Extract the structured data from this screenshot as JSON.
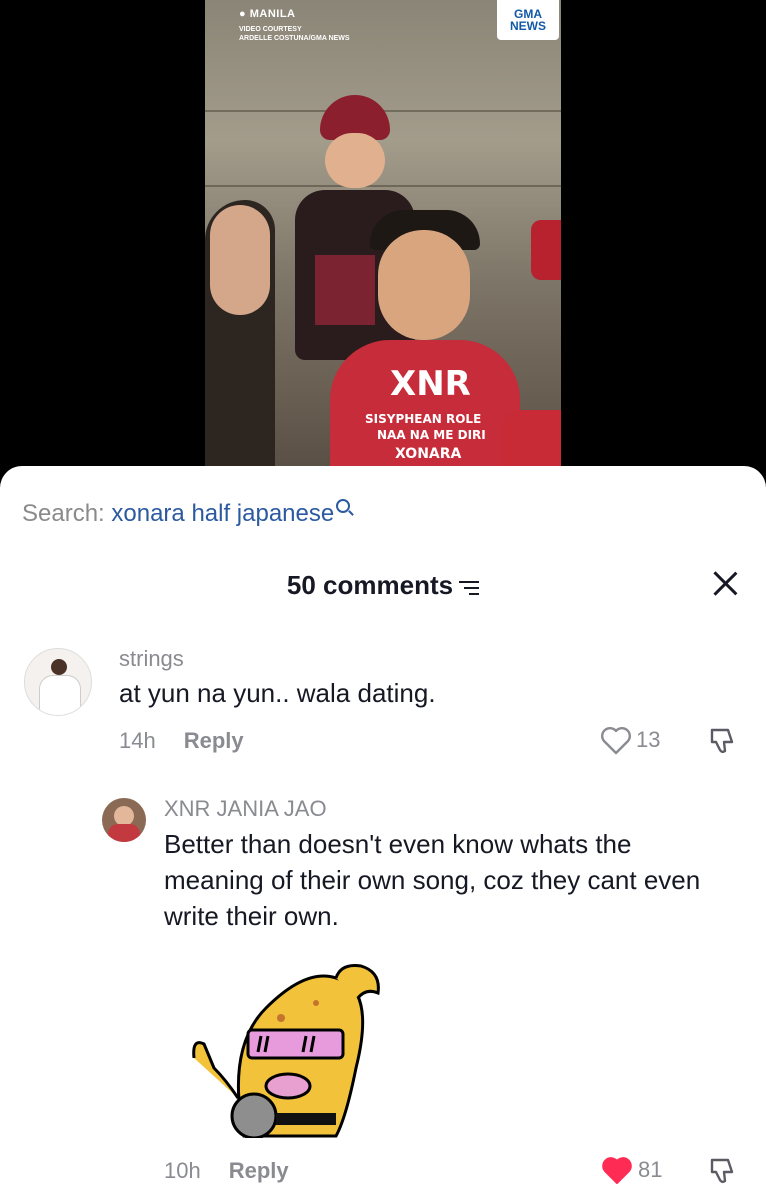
{
  "video": {
    "location": "MANILA",
    "courtesy_label": "VIDEO COURTESY",
    "courtesy_name": "ARDELLE COSTUNA/GMA NEWS",
    "logo_line1": "GMA",
    "logo_line2": "NEWS",
    "shirt_big": "XNR",
    "shirt_line1": "SISYPHEAN ROLE",
    "shirt_line2": "NAA NA ME DIRI",
    "shirt_line3": "XONARA"
  },
  "search": {
    "prefix": "Search:",
    "query": "xonara half japanese"
  },
  "comments_header": {
    "count_label": "50 comments"
  },
  "comments": [
    {
      "username": "strings",
      "text": "at yun na yun.. wala dating.",
      "time": "14h",
      "reply_label": "Reply",
      "likes": "13",
      "liked": false
    },
    {
      "username": "XNR JANIA JAO",
      "text": "Better than doesn't even know whats the meaning of their own song, coz they cant even write their own.",
      "time": "10h",
      "reply_label": "Reply",
      "likes": "81",
      "liked": true,
      "sticker": "banana-singer-sticker"
    }
  ],
  "colors": {
    "accent_blue": "#2c5aa0",
    "like_red": "#fe2c55"
  }
}
